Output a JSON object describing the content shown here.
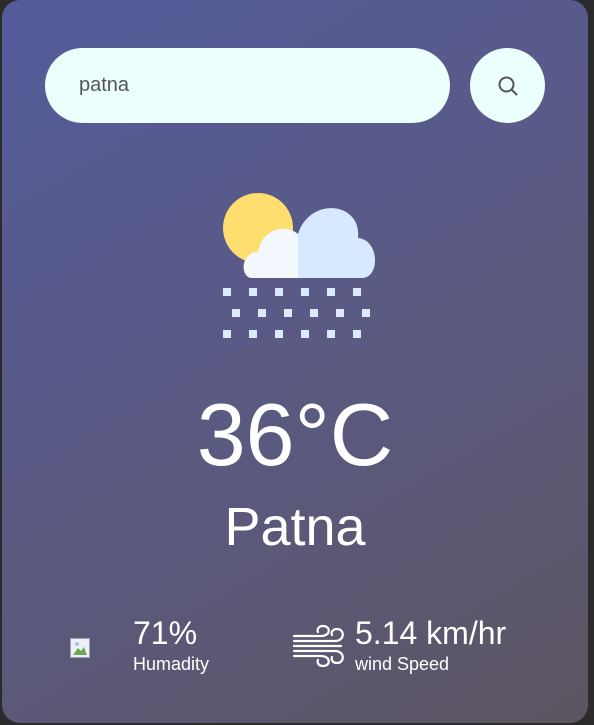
{
  "search": {
    "value": "patna",
    "button_icon": "search-icon"
  },
  "weather": {
    "icon": "cloud-snow-icon",
    "temperature": "36°C",
    "city": "Patna"
  },
  "details": {
    "humidity": {
      "value": "71%",
      "label": "Humadity",
      "icon": "humidity-icon"
    },
    "wind": {
      "value": "5.14 km/hr",
      "label": "wind Speed",
      "icon": "wind-icon"
    }
  },
  "colors": {
    "card_gradient_start": "#535b9a",
    "card_gradient_end": "#5d5460",
    "search_background": "#ebfffc",
    "text": "#ffffff"
  }
}
